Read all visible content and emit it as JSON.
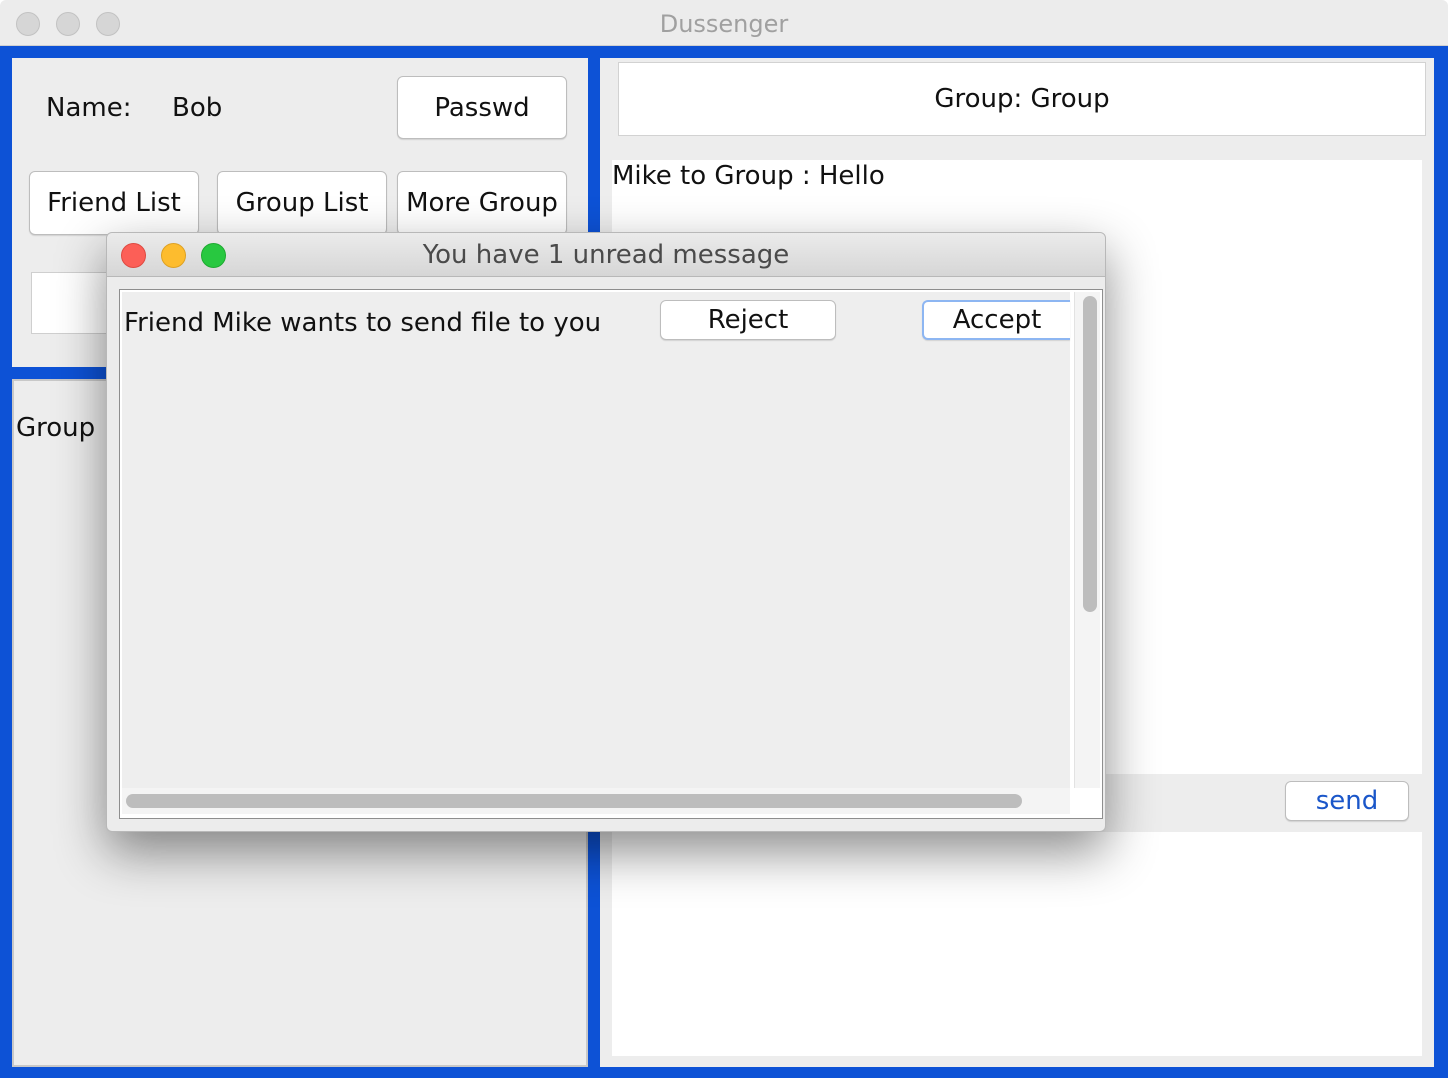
{
  "window": {
    "title": "Dussenger"
  },
  "profile": {
    "name_label": "Name:",
    "name_value": "Bob",
    "passwd_button": "Passwd"
  },
  "nav": {
    "friend_list": "Friend List",
    "group_list": "Group List",
    "more_group": "More Group"
  },
  "group_list": {
    "items": [
      "Group"
    ]
  },
  "chat": {
    "header": "Group: Group",
    "messages": [
      "Mike to Group : Hello"
    ],
    "send_button": "send"
  },
  "dialog": {
    "title": "You have 1 unread message",
    "message": "Friend Mike wants to send file to you",
    "reject_button": "Reject",
    "accept_button": "Accept"
  },
  "colors": {
    "frame_blue": "#0d52d6",
    "send_text": "#1a56c9",
    "close": "#fc5f57",
    "minimize": "#fdbc2e",
    "zoom": "#28c840"
  }
}
